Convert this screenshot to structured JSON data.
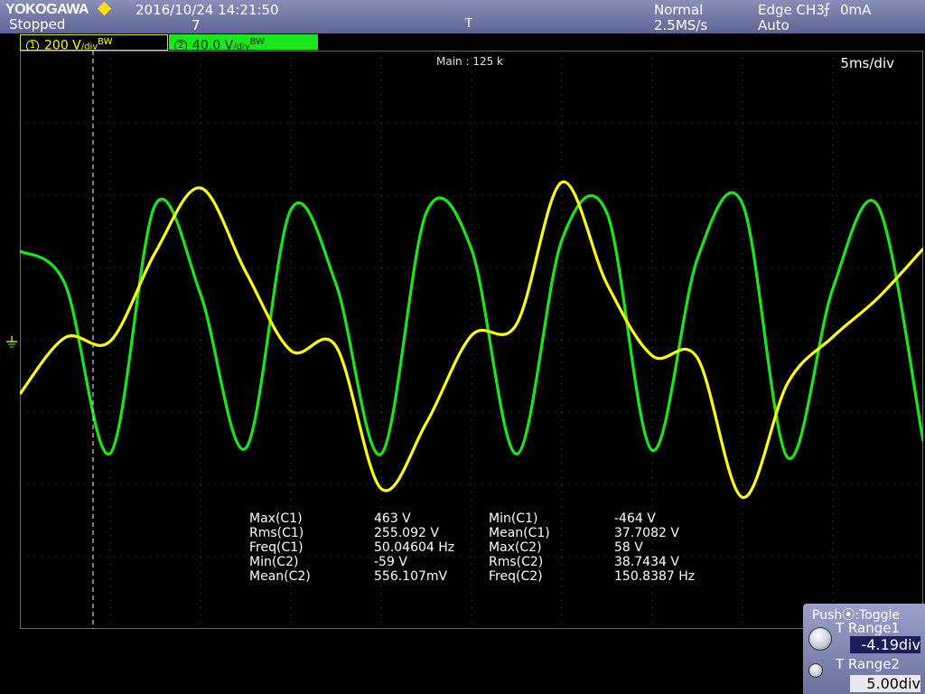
{
  "header": {
    "brand": "YOKOGAWA",
    "status": "Stopped",
    "datetime": "2016/10/24 14:21:50",
    "acq_count": "7",
    "acq_mode": "Normal",
    "sample_rate": "2.5MS/s",
    "trigger": "Edge CH3",
    "trigger_level": "0mA",
    "trigger_mode": "Auto",
    "trigger_marker": "T"
  },
  "channels": [
    {
      "number": "1",
      "scale": "200 V",
      "unit": "/div",
      "suffix": "BW",
      "color": "#ffff00"
    },
    {
      "number": "2",
      "scale": "40.0 V",
      "unit": "/div",
      "suffix": "BW",
      "color": "#18e818"
    }
  ],
  "screen": {
    "record_length": "Main : 125 k",
    "timebase": "5ms/div"
  },
  "measurements": [
    {
      "label": "Max(C1)",
      "value": "463 V"
    },
    {
      "label": "Min(C1)",
      "value": "-464 V"
    },
    {
      "label": "Rms(C1)",
      "value": "255.092 V"
    },
    {
      "label": "Mean(C1)",
      "value": "37.7082 V"
    },
    {
      "label": "Freq(C1)",
      "value": "50.04604 Hz"
    },
    {
      "label": "Max(C2)",
      "value": "58 V"
    },
    {
      "label": "Min(C2)",
      "value": "-59 V"
    },
    {
      "label": "Rms(C2)",
      "value": "38.7434 V"
    },
    {
      "label": "Mean(C2)",
      "value": "556.107mV"
    },
    {
      "label": "Freq(C2)",
      "value": "150.8387 Hz"
    }
  ],
  "panel": {
    "header": "Push",
    "toggle": ":Toggle",
    "range1_label": "T Range1",
    "range1_value": "-4.19div",
    "range2_label": "T Range2",
    "range2_value": "5.00div"
  },
  "chart_data": {
    "type": "line",
    "x_unit": "div",
    "xlim": [
      0,
      10
    ],
    "ylim": [
      -4,
      4
    ],
    "grid": true,
    "cursor_x_div": 0.81,
    "series": [
      {
        "name": "CH1",
        "color": "#ffff00",
        "x": [
          0,
          0.5,
          1,
          1.5,
          2,
          2.5,
          3,
          3.5,
          4,
          4.5,
          5,
          5.5,
          6,
          6.5,
          7,
          7.5,
          8,
          8.5,
          9,
          9.5,
          10
        ],
        "y": [
          -0.75,
          0.03,
          -0.02,
          1.21,
          2.1,
          0.94,
          -0.15,
          -0.09,
          -2.06,
          -1.15,
          0.06,
          0.22,
          2.18,
          0.77,
          -0.22,
          -0.25,
          -2.18,
          -0.6,
          0.04,
          0.58,
          1.26
        ]
      },
      {
        "name": "CH2",
        "color": "#18e818",
        "x": [
          0,
          0.5,
          1,
          1.5,
          2,
          2.5,
          3,
          3.5,
          4,
          4.5,
          5,
          5.5,
          6,
          6.5,
          7,
          7.5,
          8,
          8.5,
          9,
          9.5,
          10
        ],
        "y": [
          1.23,
          0.77,
          -1.57,
          1.87,
          0.63,
          -1.5,
          1.8,
          0.77,
          -1.58,
          1.76,
          1.25,
          -1.58,
          1.38,
          1.75,
          -1.53,
          1.12,
          1.88,
          -1.63,
          0.71,
          1.85,
          -1.4
        ]
      }
    ]
  }
}
